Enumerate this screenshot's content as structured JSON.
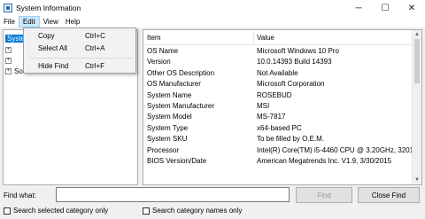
{
  "window": {
    "title": "System Information",
    "minimize": "─",
    "maximize": "☐",
    "close": "✕"
  },
  "menu": [
    "File",
    "Edit",
    "View",
    "Help"
  ],
  "tree": {
    "root": "System Summary",
    "children_visible_fragment": "Software Environment"
  },
  "context_menu": [
    {
      "label": "Copy",
      "shortcut": "Ctrl+C"
    },
    {
      "label": "Select All",
      "shortcut": "Ctrl+A"
    },
    {
      "label": "Hide Find",
      "shortcut": "Ctrl+F"
    }
  ],
  "list": {
    "headers": [
      "Item",
      "Value"
    ],
    "rows": [
      {
        "item": "OS Name",
        "value": "Microsoft Windows 10 Pro"
      },
      {
        "item": "Version",
        "value": "10.0.14393 Build 14393"
      },
      {
        "item": "Other OS Description",
        "value": "Not Available"
      },
      {
        "item": "OS Manufacturer",
        "value": "Microsoft Corporation"
      },
      {
        "item": "System Name",
        "value": "ROSEBUD"
      },
      {
        "item": "System Manufacturer",
        "value": "MSI"
      },
      {
        "item": "System Model",
        "value": "MS-7817"
      },
      {
        "item": "System Type",
        "value": "x64-based PC"
      },
      {
        "item": "System SKU",
        "value": "To be filled by O.E.M."
      },
      {
        "item": "Processor",
        "value": "Intel(R) Core(TM) i5-4460  CPU @ 3.20GHz, 3201"
      },
      {
        "item": "BIOS Version/Date",
        "value": "American Megatrends Inc. V1.9, 3/30/2015"
      }
    ]
  },
  "find": {
    "label": "Find what:",
    "value": "",
    "find_button": "Find",
    "close_button": "Close Find",
    "check_selected": "Search selected category only",
    "check_names": "Search category names only"
  }
}
